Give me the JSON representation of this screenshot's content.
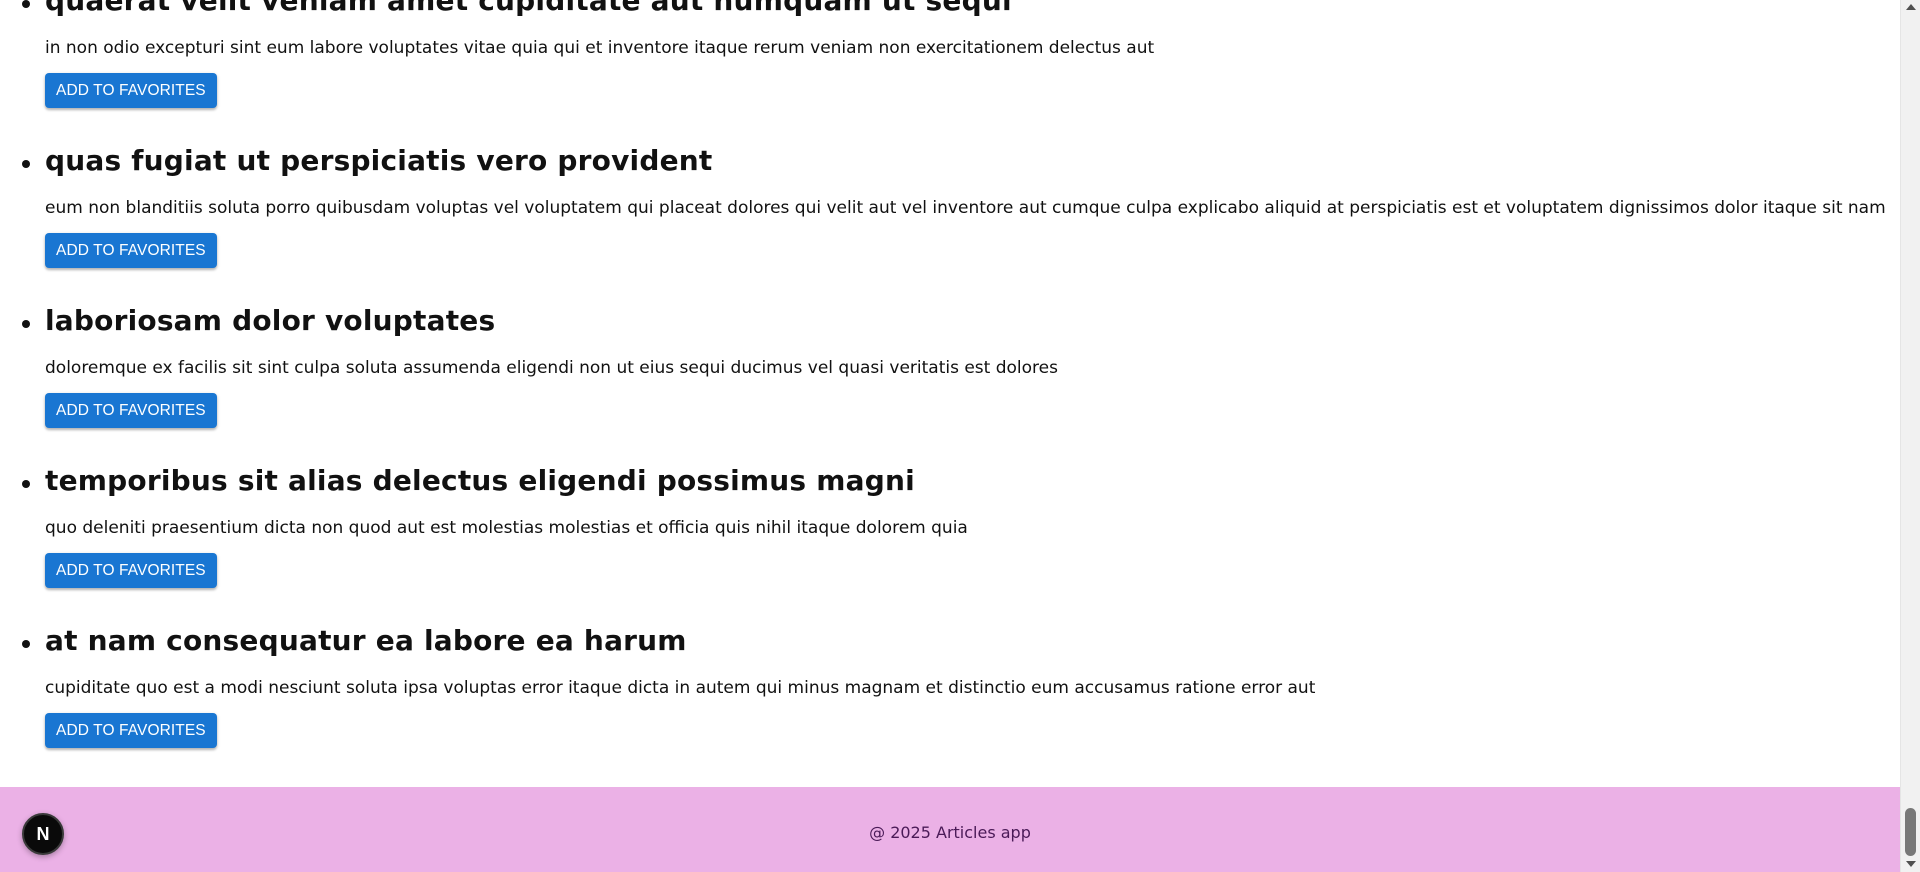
{
  "articles": [
    {
      "title": "quaerat velit veniam amet cupiditate aut numquam ut sequi",
      "body": "in non odio excepturi sint eum labore voluptates vitae quia qui et inventore itaque rerum veniam non exercitationem delectus aut",
      "button_label": "ADD TO FAVORITES"
    },
    {
      "title": "quas fugiat ut perspiciatis vero provident",
      "body": "eum non blanditiis soluta porro quibusdam voluptas vel voluptatem qui placeat dolores qui velit aut vel inventore aut cumque culpa explicabo aliquid at perspiciatis est et voluptatem dignissimos dolor itaque sit nam",
      "button_label": "ADD TO FAVORITES"
    },
    {
      "title": "laboriosam dolor voluptates",
      "body": "doloremque ex facilis sit sint culpa soluta assumenda eligendi non ut eius sequi ducimus vel quasi veritatis est dolores",
      "button_label": "ADD TO FAVORITES"
    },
    {
      "title": "temporibus sit alias delectus eligendi possimus magni",
      "body": "quo deleniti praesentium dicta non quod aut est molestias molestias et officia quis nihil itaque dolorem quia",
      "button_label": "ADD TO FAVORITES"
    },
    {
      "title": "at nam consequatur ea labore ea harum",
      "body": "cupiditate quo est a modi nesciunt soluta ipsa voluptas error itaque dicta in autem qui minus magnam et distinctio eum accusamus ratione error aut",
      "button_label": "ADD TO FAVORITES"
    }
  ],
  "footer": {
    "text": "@ 2025 Articles app"
  },
  "dev_badge": {
    "letter": "N",
    "icon": "nextjs-icon"
  },
  "colors": {
    "button": "#1976d2",
    "footer_bg": "#ebb1e6",
    "footer_text": "#4a1a57"
  }
}
